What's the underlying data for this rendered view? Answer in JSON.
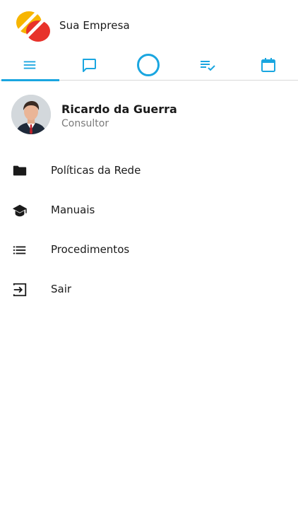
{
  "header": {
    "company_name": "Sua Empresa",
    "logo_icon": "company-logo"
  },
  "tabs": [
    {
      "id": "menu",
      "icon": "hamburger-menu-icon",
      "active": true
    },
    {
      "id": "messages",
      "icon": "chat-bubble-icon",
      "active": false
    },
    {
      "id": "home",
      "icon": "circle-icon",
      "active": false
    },
    {
      "id": "tasks",
      "icon": "checklist-icon",
      "active": false
    },
    {
      "id": "calendar",
      "icon": "calendar-icon",
      "active": false
    }
  ],
  "profile": {
    "name": "Ricardo da Guerra",
    "role": "Consultor"
  },
  "menu": {
    "items": [
      {
        "label": "Políticas da Rede",
        "icon": "folder-icon"
      },
      {
        "label": "Manuais",
        "icon": "graduation-cap-icon"
      },
      {
        "label": "Procedimentos",
        "icon": "list-icon"
      },
      {
        "label": "Sair",
        "icon": "exit-icon"
      }
    ]
  },
  "colors": {
    "accent": "#1aa6e0",
    "text_primary": "#1a1a1a",
    "text_secondary": "#7a7a7a",
    "logo_yellow": "#f7b500",
    "logo_red": "#e8322b"
  }
}
